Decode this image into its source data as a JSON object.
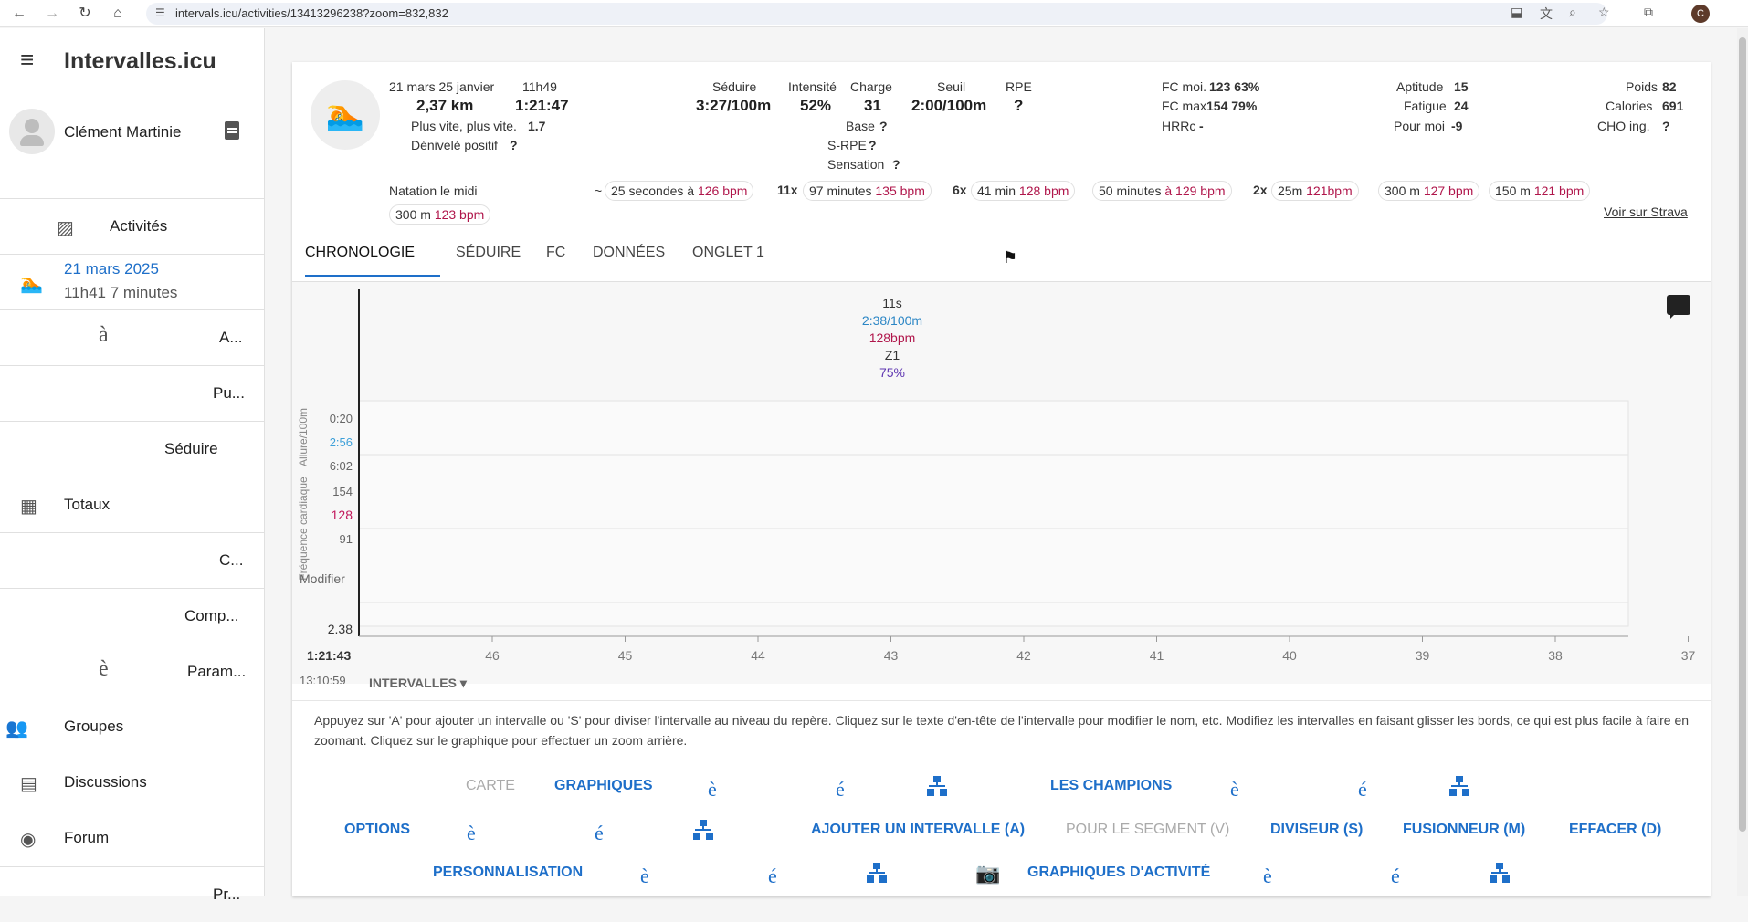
{
  "browser": {
    "url": "intervals.icu/activities/13413296238?zoom=832,832",
    "profile_initial": "C"
  },
  "sidebar": {
    "app_title": "Intervalles.icu",
    "user_name": "Clément Martinie",
    "items": [
      {
        "label": "Activités",
        "icon": "activity-icon"
      },
      {
        "date": "21 mars 2025",
        "sub": "11h41 7   minutes",
        "icon": "swim-icon"
      },
      {
        "glyph": "à",
        "label": "A..."
      },
      {
        "label": "Pu..."
      },
      {
        "label": "Séduire"
      },
      {
        "label": "Totaux",
        "icon": "totals-icon"
      },
      {
        "label": "C..."
      },
      {
        "label": "Comp..."
      },
      {
        "glyph": "è",
        "label": "Param..."
      },
      {
        "label": "Groupes",
        "icon": "groups-icon"
      },
      {
        "label": "Discussions",
        "icon": "chat-icon"
      },
      {
        "label": "Forum",
        "icon": "forum-icon"
      },
      {
        "label": "Pr..."
      }
    ]
  },
  "summary": {
    "date": "21 mars 25 janvier",
    "time": "11h49",
    "distance": "2,37 km",
    "duration": "1:21:47",
    "faster_label": "Plus vite, plus vite.",
    "faster_value": "1.7",
    "elev_label": "Dénivelé positif",
    "elev_value": "?",
    "stats": [
      {
        "label": "Séduire",
        "value": "3:27/100m"
      },
      {
        "label": "Intensité",
        "value": "52%"
      },
      {
        "label": "Charge",
        "value": "31"
      },
      {
        "label": "Seuil",
        "value": "2:00/100m"
      },
      {
        "label": "RPE",
        "value": "?"
      }
    ],
    "base_label": "Base",
    "base_value": "?",
    "srpe_label": "S-RPE",
    "srpe_value": "?",
    "sensation_label": "Sensation",
    "sensation_value": "?",
    "hr_avg_label": "FC moi.",
    "hr_avg_value": "123 63%",
    "hr_max_label": "FC max",
    "hr_max_value": "154 79%",
    "hrrc_label": "HRRc",
    "hrrc_value": "-",
    "fitness_label": "Aptitude",
    "fitness_value": "15",
    "fatigue_label": "Fatigue",
    "fatigue_value": "24",
    "form_label": "Pour moi",
    "form_value": "-9",
    "weight_label": "Poids",
    "weight_value": "82",
    "calories_label": "Calories",
    "calories_value": "691",
    "cho_label": "CHO ing.",
    "cho_value": "?",
    "name": "Natation le midi",
    "tilde": "~",
    "intervals": [
      {
        "prefix": "",
        "text": "25 secondes à",
        "hr": "126 bpm"
      },
      {
        "prefix": "11x",
        "text": "97 minutes",
        "hr": "135 bpm"
      },
      {
        "prefix": "6x",
        "text": "41 min",
        "hr": "128 bpm"
      },
      {
        "prefix": "",
        "text": "50 minutes",
        "hr": "à 129 bpm"
      },
      {
        "prefix": "2x",
        "text": "25m",
        "hr": "121bpm"
      },
      {
        "prefix": "",
        "text": "300 m",
        "hr": "127 bpm"
      },
      {
        "prefix": "",
        "text": "150 m",
        "hr": "121 bpm"
      },
      {
        "prefix": "",
        "text": "300 m",
        "hr": "123 bpm"
      }
    ],
    "strava_link": "Voir sur Strava"
  },
  "tabs": [
    "CHRONOLOGIE",
    "SÉDUIRE",
    "FC",
    "DONNÉES",
    "ONGLET 1"
  ],
  "chart": {
    "hover": {
      "duration": "11s",
      "pace": "2:38/100m",
      "hr": "128bpm",
      "zone": "Z1",
      "pct": "75%"
    },
    "pace_axis": {
      "label": "Allure/100m",
      "ticks": [
        "0:20",
        "2:56",
        "6:02"
      ]
    },
    "hr_axis": {
      "label": "Fréquence cardiaque",
      "ticks": [
        "154",
        "128",
        "91"
      ]
    },
    "modify_label": "Modifier",
    "bottom_value": "2.38",
    "x_start": "1:21:43",
    "x_ticks": [
      "46",
      "45",
      "44",
      "43",
      "42",
      "41",
      "40",
      "39",
      "38",
      "37"
    ],
    "clock": "13:10:59",
    "intervals_dropdown": "INTERVALLES",
    "colors": {
      "pace": "#3da0d9",
      "hr": "#c2185b",
      "zone": "#333333",
      "pct": "#5e35b1"
    }
  },
  "info_text": "Appuyez sur 'A' pour ajouter un intervalle ou 'S' pour diviser l'intervalle au niveau du repère. Cliquez sur le texte d'en-tête de l'intervalle pour modifier le nom, etc. Modifiez les intervalles en faisant glisser les bords, ce qui est plus facile à faire en zoomant. Cliquez sur le graphique pour effectuer un zoom arrière.",
  "actions": {
    "map": "CARTE",
    "charts": "GRAPHIQUES",
    "champions": "LES CHAMPIONS",
    "options": "OPTIONS",
    "add_interval": "AJOUTER UN INTERVALLE (A)",
    "for_segment": "POUR LE SEGMENT (V)",
    "splitter": "DIVISEUR (S)",
    "merger": "FUSIONNEUR (M)",
    "erase": "EFFACER (D)",
    "customization": "PERSONNALISATION",
    "activity_charts": "GRAPHIQUES D'ACTIVITÉ",
    "g1": "è",
    "g2": "é"
  }
}
